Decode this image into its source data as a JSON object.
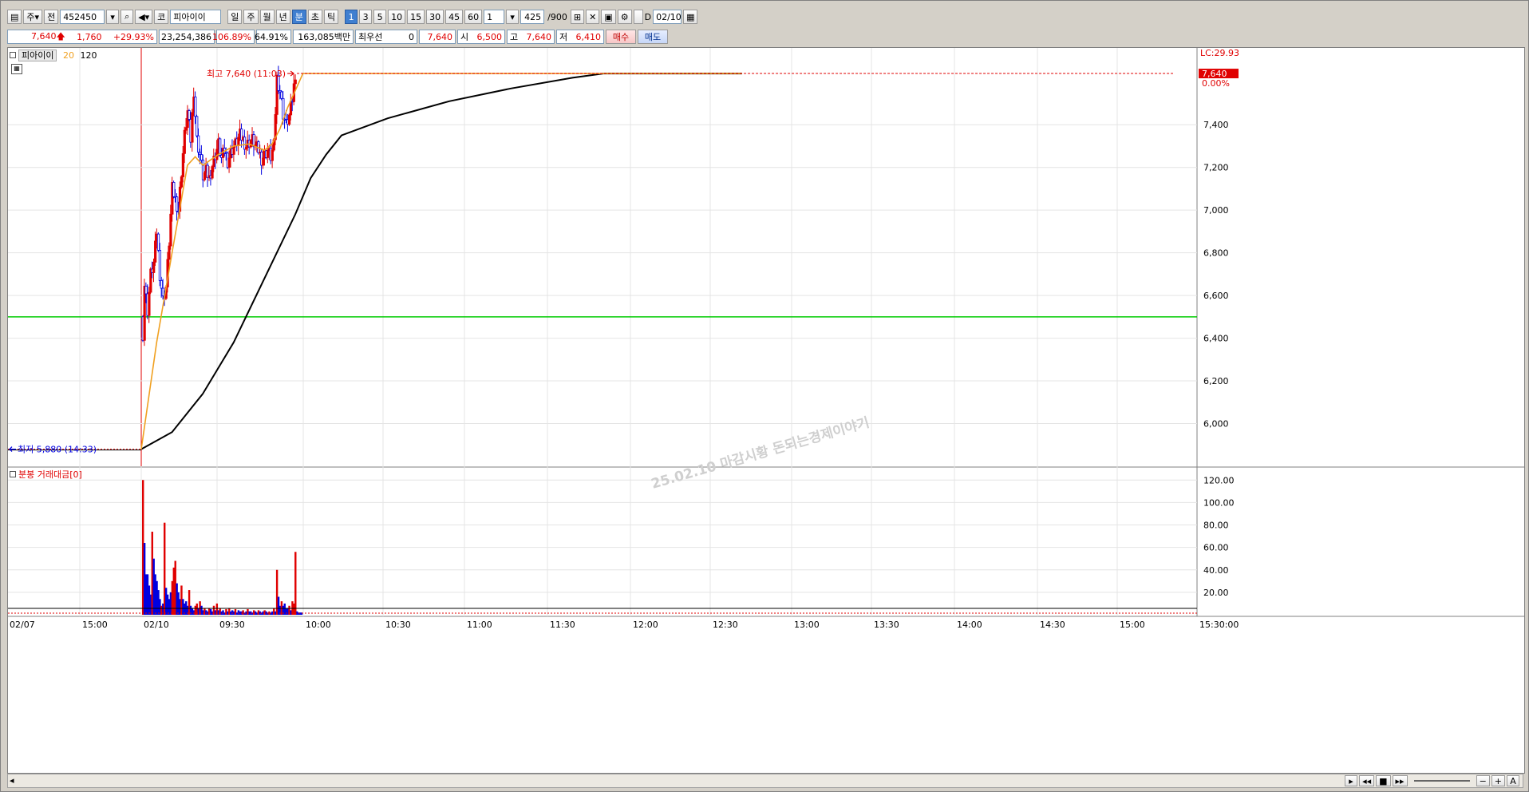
{
  "toolbar": {
    "market": "주",
    "scope": "전",
    "code": "452450",
    "name_prefix": "코",
    "name": "피아이이",
    "periods": [
      "일",
      "주",
      "월",
      "년",
      "분",
      "초",
      "틱"
    ],
    "minute_options": [
      "1",
      "3",
      "5",
      "10",
      "15",
      "30",
      "45",
      "60"
    ],
    "selected_period": "분",
    "selected_minute": "1",
    "unit": "1",
    "count": "425",
    "count_total": "/900",
    "date_checkbox_label": "D",
    "date": "02/10"
  },
  "quote": {
    "price": "7,640",
    "change": "1,760",
    "change_pct": "+29.93%",
    "volume": "23,254,386",
    "vol_ratio": "106.89%",
    "turnover_ratio": "64.91%",
    "amount": "163,085백만",
    "best_label": "최우선",
    "best_qty": "0",
    "best_price": "7,640",
    "open_label": "시",
    "open": "6,500",
    "high_label": "고",
    "high": "7,640",
    "low_label": "저",
    "low": "6,410",
    "buy_label": "매수",
    "sell_label": "매도"
  },
  "colors": {
    "up": "#e00000",
    "down": "#0000e0",
    "ma20": "#f0a020",
    "ma120": "#000000",
    "hline": "#00cc00"
  },
  "chart_data": [
    {
      "type": "candlestick",
      "legend": {
        "name": "피아이이",
        "ma_short": "20",
        "ma_long": "120"
      },
      "top_right_label": "LC:29.93",
      "current_price_label": "7,640",
      "current_pct_label": "0.00%",
      "ylim": [
        5800,
        7730
      ],
      "yticks": [
        6000,
        6200,
        6400,
        6600,
        6800,
        7000,
        7200,
        7400
      ],
      "ytick_labels": [
        "6,000",
        "6,200",
        "6,400",
        "6,600",
        "6,800",
        "7,000",
        "7,200",
        "7,400"
      ],
      "xticks": [
        "02/07",
        "15:00",
        "02/10",
        "09:30",
        "10:00",
        "10:30",
        "11:00",
        "11:30",
        "12:00",
        "12:30",
        "13:00",
        "13:30",
        "14:00",
        "14:30",
        "15:00",
        "15:30:00"
      ],
      "high_annotation": "최고 7,640 (11:03)",
      "low_annotation": "최저 5,880 (14:33)",
      "watermark": "25.02.10 마감시황 돈되는경제이야기",
      "horizontal_line": 6500,
      "prev_close_level": 5880,
      "candle_anchors": [
        [
          0,
          6420
        ],
        [
          1,
          6650
        ],
        [
          3,
          6530
        ],
        [
          5,
          6700
        ],
        [
          7,
          6750
        ],
        [
          9,
          6900
        ],
        [
          11,
          6700
        ],
        [
          13,
          6580
        ],
        [
          15,
          6640
        ],
        [
          17,
          6850
        ],
        [
          19,
          7100
        ],
        [
          21,
          7050
        ],
        [
          23,
          7000
        ],
        [
          25,
          7180
        ],
        [
          27,
          7350
        ],
        [
          29,
          7460
        ],
        [
          31,
          7330
        ],
        [
          33,
          7560
        ],
        [
          35,
          7330
        ],
        [
          37,
          7260
        ],
        [
          39,
          7160
        ],
        [
          41,
          7180
        ],
        [
          43,
          7150
        ],
        [
          45,
          7210
        ],
        [
          47,
          7260
        ],
        [
          49,
          7310
        ],
        [
          51,
          7240
        ],
        [
          53,
          7280
        ],
        [
          55,
          7230
        ],
        [
          57,
          7270
        ],
        [
          59,
          7300
        ],
        [
          61,
          7320
        ],
        [
          63,
          7350
        ],
        [
          65,
          7330
        ],
        [
          67,
          7300
        ],
        [
          69,
          7320
        ],
        [
          71,
          7330
        ],
        [
          73,
          7300
        ],
        [
          75,
          7280
        ],
        [
          77,
          7240
        ],
        [
          79,
          7260
        ],
        [
          81,
          7280
        ],
        [
          83,
          7250
        ],
        [
          85,
          7300
        ],
        [
          87,
          7620
        ],
        [
          89,
          7560
        ],
        [
          91,
          7450
        ],
        [
          93,
          7400
        ],
        [
          95,
          7440
        ],
        [
          97,
          7520
        ],
        [
          99,
          7640
        ]
      ],
      "ma20_anchors": [
        [
          0,
          5880
        ],
        [
          10,
          6380
        ],
        [
          20,
          6800
        ],
        [
          30,
          7210
        ],
        [
          35,
          7250
        ],
        [
          40,
          7210
        ],
        [
          50,
          7260
        ],
        [
          60,
          7300
        ],
        [
          70,
          7310
        ],
        [
          80,
          7280
        ],
        [
          85,
          7310
        ],
        [
          90,
          7380
        ],
        [
          95,
          7480
        ],
        [
          100,
          7560
        ],
        [
          105,
          7640
        ],
        [
          390,
          7640
        ]
      ],
      "ma120_anchors": [
        [
          0,
          5880
        ],
        [
          20,
          5960
        ],
        [
          40,
          6140
        ],
        [
          60,
          6380
        ],
        [
          80,
          6680
        ],
        [
          100,
          6980
        ],
        [
          110,
          7150
        ],
        [
          120,
          7260
        ],
        [
          130,
          7350
        ],
        [
          160,
          7430
        ],
        [
          200,
          7510
        ],
        [
          240,
          7570
        ],
        [
          280,
          7620
        ],
        [
          300,
          7640
        ],
        [
          390,
          7640
        ]
      ]
    },
    {
      "type": "bar",
      "legend": {
        "name": "분봉 거래대금[0]"
      },
      "ylim": [
        0,
        128
      ],
      "yticks": [
        20,
        40,
        60,
        80,
        100,
        120
      ],
      "ytick_labels": [
        "20.00",
        "40.00",
        "60.00",
        "80.00",
        "100.00",
        "120.00"
      ],
      "minutes": [
        0,
        1,
        2,
        3,
        4,
        5,
        6,
        7,
        8,
        9,
        10,
        11,
        12,
        13,
        14,
        15,
        16,
        17,
        18,
        19,
        20,
        21,
        22,
        23,
        24,
        25,
        26,
        27,
        28,
        29,
        30,
        31,
        32,
        33,
        34,
        35,
        36,
        37,
        38,
        39,
        40,
        41,
        42,
        43,
        44,
        45,
        46,
        47,
        48,
        49,
        50,
        51,
        52,
        53,
        54,
        55,
        56,
        57,
        58,
        59,
        60,
        61,
        62,
        63,
        64,
        65,
        66,
        67,
        68,
        69,
        70,
        71,
        72,
        73,
        74,
        75,
        76,
        77,
        78,
        79,
        80,
        81,
        82,
        83,
        84,
        85,
        86,
        87,
        88,
        89,
        90,
        91,
        92,
        93,
        94,
        95,
        96,
        97,
        98,
        99,
        100,
        101,
        102,
        103
      ],
      "values": [
        120,
        64,
        36,
        36,
        26,
        18,
        74,
        50,
        36,
        30,
        22,
        14,
        8,
        10,
        82,
        24,
        18,
        14,
        20,
        30,
        42,
        48,
        28,
        20,
        14,
        26,
        14,
        10,
        12,
        8,
        22,
        8,
        6,
        4,
        8,
        10,
        6,
        12,
        8,
        4,
        6,
        4,
        3,
        6,
        5,
        3,
        8,
        4,
        10,
        4,
        6,
        3,
        4,
        2,
        5,
        3,
        6,
        3,
        4,
        3,
        5,
        2,
        4,
        3,
        3,
        4,
        2,
        3,
        5,
        3,
        3,
        2,
        4,
        3,
        2,
        4,
        3,
        2,
        3,
        4,
        3,
        2,
        3,
        2,
        3,
        6,
        3,
        40,
        16,
        8,
        12,
        8,
        10,
        6,
        6,
        8,
        4,
        12,
        10,
        56,
        3,
        2,
        2,
        2
      ],
      "up": [
        1,
        0,
        0,
        0,
        0,
        0,
        1,
        0,
        0,
        0,
        0,
        0,
        1,
        0,
        1,
        0,
        0,
        0,
        0,
        1,
        1,
        1,
        0,
        0,
        0,
        1,
        0,
        0,
        0,
        0,
        1,
        0,
        0,
        0,
        1,
        1,
        0,
        1,
        0,
        0,
        1,
        0,
        0,
        1,
        0,
        0,
        1,
        0,
        1,
        0,
        1,
        0,
        0,
        0,
        1,
        0,
        1,
        0,
        0,
        0,
        1,
        0,
        0,
        0,
        0,
        1,
        0,
        0,
        1,
        0,
        0,
        0,
        1,
        0,
        0,
        1,
        0,
        0,
        0,
        1,
        0,
        0,
        1,
        0,
        0,
        1,
        0,
        1,
        0,
        0,
        1,
        0,
        0,
        0,
        0,
        1,
        0,
        1,
        1,
        1,
        0,
        0,
        0,
        0
      ]
    }
  ]
}
